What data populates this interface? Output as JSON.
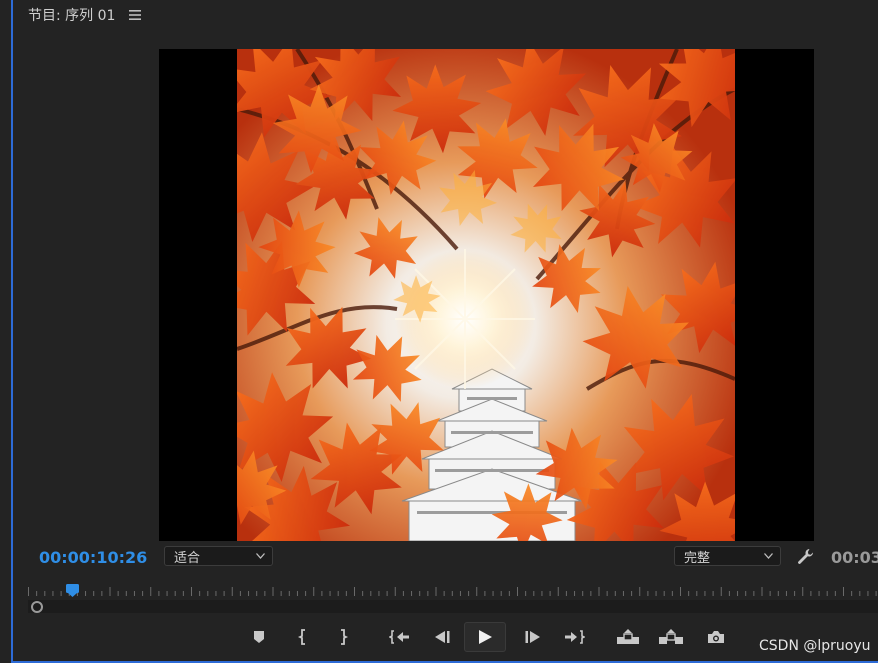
{
  "panel": {
    "title": "节目: 序列 01",
    "menu_icon": "hamburger-icon"
  },
  "viewer": {
    "image": "autumn-maple-leaves-over-white-castle"
  },
  "playback": {
    "current_timecode": "00:00:10:26",
    "duration_timecode": "00:03",
    "zoom_value": "适合",
    "quality_value": "完整",
    "settings_icon": "wrench-icon"
  },
  "transport": {
    "buttons": [
      "add-marker",
      "mark-in",
      "mark-out",
      "go-to-in",
      "step-back",
      "play",
      "step-forward",
      "go-to-out",
      "lift",
      "extract",
      "export-frame"
    ]
  },
  "colors": {
    "accent": "#2d6bd6",
    "timecode": "#2f8ee6",
    "background": "#232323"
  },
  "watermark": {
    "text": "CSDN @lpruoyu"
  }
}
